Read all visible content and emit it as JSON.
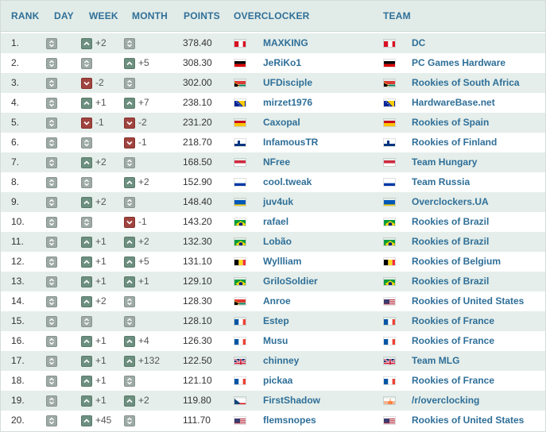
{
  "headers": {
    "rank": "RANK",
    "day": "DAY",
    "week": "WEEK",
    "month": "MONTH",
    "points": "POINTS",
    "overclocker": "OVERCLOCKER",
    "team": "TEAM"
  },
  "colors": {
    "header_text": "#2f6f98",
    "link": "#2f6f98",
    "stripe": "#e5eeea",
    "up": "#6d8f7f",
    "down": "#a0443f",
    "neutral": "#9eaaa5"
  },
  "rows": [
    {
      "rank": "1.",
      "day": {
        "dir": "neutral",
        "val": ""
      },
      "week": {
        "dir": "up",
        "val": "+2"
      },
      "month": {
        "dir": "neutral",
        "val": ""
      },
      "points": "378.40",
      "flag": "peru",
      "name": "MAXKING",
      "team_flag": "peru",
      "team": "DC"
    },
    {
      "rank": "2.",
      "day": {
        "dir": "neutral",
        "val": ""
      },
      "week": {
        "dir": "neutral",
        "val": ""
      },
      "month": {
        "dir": "up",
        "val": "+5"
      },
      "points": "308.30",
      "flag": "germany",
      "name": "JeRiKo1",
      "team_flag": "germany",
      "team": "PC Games Hardware"
    },
    {
      "rank": "3.",
      "day": {
        "dir": "neutral",
        "val": ""
      },
      "week": {
        "dir": "down",
        "val": "-2"
      },
      "month": {
        "dir": "neutral",
        "val": ""
      },
      "points": "302.00",
      "flag": "south_africa",
      "name": "UFDisciple",
      "team_flag": "south_africa",
      "team": "Rookies of South Africa"
    },
    {
      "rank": "4.",
      "day": {
        "dir": "neutral",
        "val": ""
      },
      "week": {
        "dir": "up",
        "val": "+1"
      },
      "month": {
        "dir": "up",
        "val": "+7"
      },
      "points": "238.10",
      "flag": "bosnia",
      "name": "mirzet1976",
      "team_flag": "bosnia",
      "team": "HardwareBase.net"
    },
    {
      "rank": "5.",
      "day": {
        "dir": "neutral",
        "val": ""
      },
      "week": {
        "dir": "down",
        "val": "-1"
      },
      "month": {
        "dir": "down",
        "val": "-2"
      },
      "points": "231.20",
      "flag": "spain",
      "name": "Caxopal",
      "team_flag": "spain",
      "team": "Rookies of Spain"
    },
    {
      "rank": "6.",
      "day": {
        "dir": "neutral",
        "val": ""
      },
      "week": {
        "dir": "neutral",
        "val": ""
      },
      "month": {
        "dir": "down",
        "val": "-1"
      },
      "points": "218.70",
      "flag": "finland",
      "name": "InfamousTR",
      "team_flag": "finland",
      "team": "Rookies of Finland"
    },
    {
      "rank": "7.",
      "day": {
        "dir": "neutral",
        "val": ""
      },
      "week": {
        "dir": "up",
        "val": "+2"
      },
      "month": {
        "dir": "neutral",
        "val": ""
      },
      "points": "168.50",
      "flag": "hungary",
      "name": "NFree",
      "team_flag": "hungary",
      "team": "Team Hungary"
    },
    {
      "rank": "8.",
      "day": {
        "dir": "neutral",
        "val": ""
      },
      "week": {
        "dir": "neutral",
        "val": ""
      },
      "month": {
        "dir": "up",
        "val": "+2"
      },
      "points": "152.90",
      "flag": "russia",
      "name": "cool.tweak",
      "team_flag": "russia",
      "team": "Team Russia"
    },
    {
      "rank": "9.",
      "day": {
        "dir": "neutral",
        "val": ""
      },
      "week": {
        "dir": "up",
        "val": "+2"
      },
      "month": {
        "dir": "neutral",
        "val": ""
      },
      "points": "148.40",
      "flag": "ukraine",
      "name": "juv4uk",
      "team_flag": "ukraine",
      "team": "Overclockers.UA"
    },
    {
      "rank": "10.",
      "day": {
        "dir": "neutral",
        "val": ""
      },
      "week": {
        "dir": "neutral",
        "val": ""
      },
      "month": {
        "dir": "down",
        "val": "-1"
      },
      "points": "143.20",
      "flag": "brazil",
      "name": "rafael",
      "team_flag": "brazil",
      "team": "Rookies of Brazil"
    },
    {
      "rank": "11.",
      "day": {
        "dir": "neutral",
        "val": ""
      },
      "week": {
        "dir": "up",
        "val": "+1"
      },
      "month": {
        "dir": "up",
        "val": "+2"
      },
      "points": "132.30",
      "flag": "brazil",
      "name": "Lobão",
      "team_flag": "brazil",
      "team": "Rookies of Brazil"
    },
    {
      "rank": "12.",
      "day": {
        "dir": "neutral",
        "val": ""
      },
      "week": {
        "dir": "up",
        "val": "+1"
      },
      "month": {
        "dir": "up",
        "val": "+5"
      },
      "points": "131.10",
      "flag": "belgium",
      "name": "Wyllliam",
      "team_flag": "belgium",
      "team": "Rookies of Belgium"
    },
    {
      "rank": "13.",
      "day": {
        "dir": "neutral",
        "val": ""
      },
      "week": {
        "dir": "up",
        "val": "+1"
      },
      "month": {
        "dir": "up",
        "val": "+1"
      },
      "points": "129.10",
      "flag": "brazil",
      "name": "GriloSoldier",
      "team_flag": "brazil",
      "team": "Rookies of Brazil"
    },
    {
      "rank": "14.",
      "day": {
        "dir": "neutral",
        "val": ""
      },
      "week": {
        "dir": "up",
        "val": "+2"
      },
      "month": {
        "dir": "neutral",
        "val": ""
      },
      "points": "128.30",
      "flag": "south_africa",
      "name": "Anroe",
      "team_flag": "usa",
      "team": "Rookies of United States"
    },
    {
      "rank": "15.",
      "day": {
        "dir": "neutral",
        "val": ""
      },
      "week": {
        "dir": "neutral",
        "val": ""
      },
      "month": {
        "dir": "neutral",
        "val": ""
      },
      "points": "128.10",
      "flag": "france",
      "name": "Estep",
      "team_flag": "france",
      "team": "Rookies of France"
    },
    {
      "rank": "16.",
      "day": {
        "dir": "neutral",
        "val": ""
      },
      "week": {
        "dir": "up",
        "val": "+1"
      },
      "month": {
        "dir": "up",
        "val": "+4"
      },
      "points": "126.30",
      "flag": "france",
      "name": "Musu",
      "team_flag": "france",
      "team": "Rookies of France"
    },
    {
      "rank": "17.",
      "day": {
        "dir": "neutral",
        "val": ""
      },
      "week": {
        "dir": "up",
        "val": "+1"
      },
      "month": {
        "dir": "up",
        "val": "+132"
      },
      "points": "122.50",
      "flag": "uk",
      "name": "chinney",
      "team_flag": "uk",
      "team": "Team MLG"
    },
    {
      "rank": "18.",
      "day": {
        "dir": "neutral",
        "val": ""
      },
      "week": {
        "dir": "up",
        "val": "+1"
      },
      "month": {
        "dir": "neutral",
        "val": ""
      },
      "points": "121.10",
      "flag": "france",
      "name": "pickaa",
      "team_flag": "france",
      "team": "Rookies of France"
    },
    {
      "rank": "19.",
      "day": {
        "dir": "neutral",
        "val": ""
      },
      "week": {
        "dir": "up",
        "val": "+1"
      },
      "month": {
        "dir": "up",
        "val": "+2"
      },
      "points": "119.80",
      "flag": "czech",
      "name": "FirstShadow",
      "team_flag": "reddit",
      "team": "/r/overclocking"
    },
    {
      "rank": "20.",
      "day": {
        "dir": "neutral",
        "val": ""
      },
      "week": {
        "dir": "up",
        "val": "+45"
      },
      "month": {
        "dir": "neutral",
        "val": ""
      },
      "points": "111.70",
      "flag": "usa",
      "name": "flemsnopes",
      "team_flag": "usa",
      "team": "Rookies of United States"
    }
  ]
}
